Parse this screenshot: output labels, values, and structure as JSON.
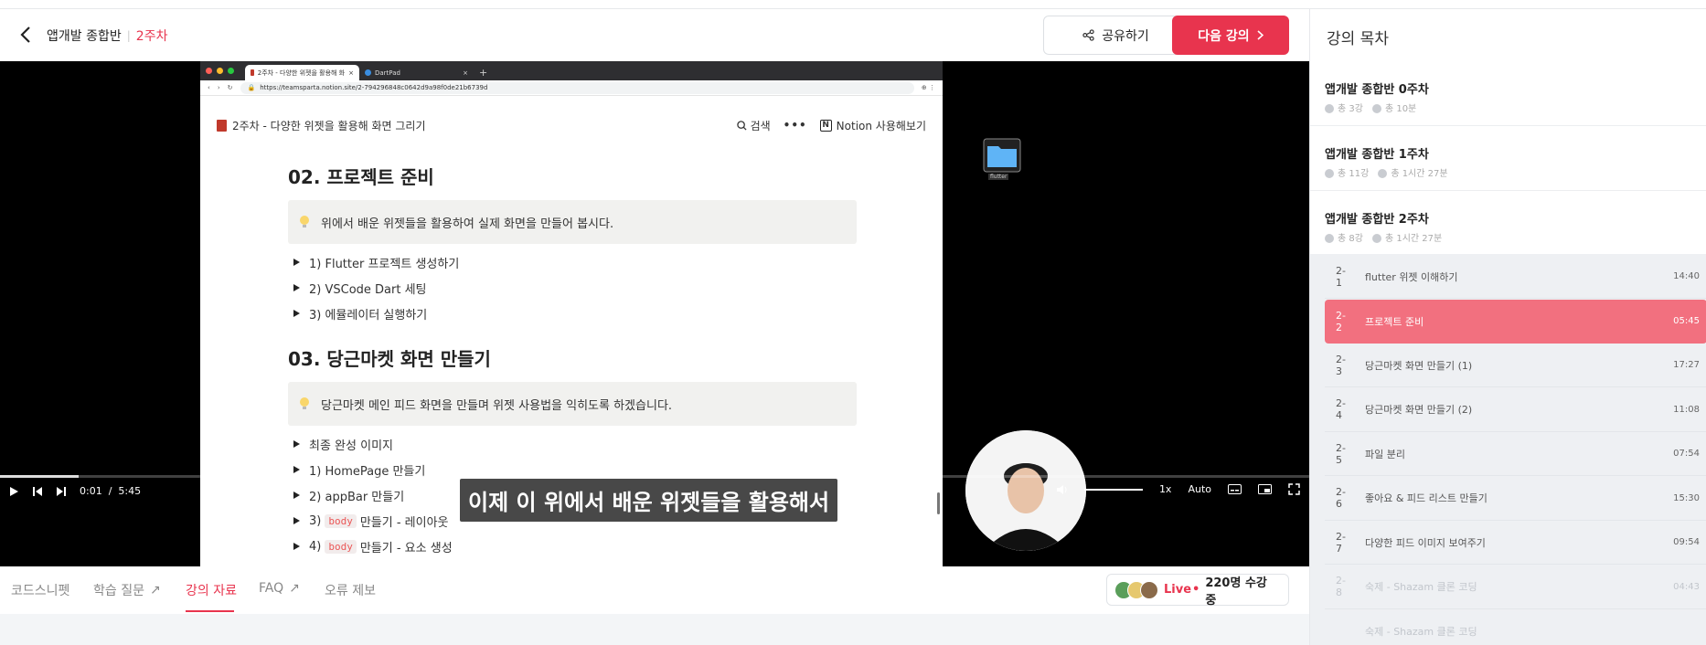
{
  "header": {
    "course": "앱개발 종합반",
    "week": "2주차",
    "share_label": "공유하기",
    "next_label": "다음 강의"
  },
  "browser": {
    "tabs": [
      {
        "label": "2주차 - 다양한 위젯을 활용해 화",
        "active": true
      },
      {
        "label": "DartPad",
        "active": false
      }
    ],
    "url": "https://teamsparta.notion.site/2-794296848c0642d9a98f0de21b6739d"
  },
  "notion": {
    "page_title": "2주차 - 다양한 위젯을 활용해 화면 그리기",
    "search_label": "검색",
    "more_label": "•••",
    "open_label": "Notion 사용해보기",
    "section1": {
      "heading": "02. 프로젝트 준비",
      "callout": "위에서 배운 위젯들을 활용하여 실제 화면을 만들어 봅시다.",
      "items": [
        "1) Flutter 프로젝트 생성하기",
        "2) VSCode Dart 세팅",
        "3) 에뮬레이터 실행하기"
      ]
    },
    "section2": {
      "heading": "03. 당근마켓 화면 만들기",
      "callout": "당근마켓 메인 피드 화면을 만들며 위젯 사용법을 익히도록 하겠습니다.",
      "items": [
        "최종 완성 이미지",
        "1) HomePage 만들기",
        "2) appBar 만들기"
      ],
      "code_items": [
        {
          "prefix": "3)",
          "code": "body",
          "suffix": "만들기 - 레이아웃"
        },
        {
          "prefix": "4)",
          "code": "body",
          "suffix": "만들기 - 요소 생성"
        }
      ]
    }
  },
  "desktop": {
    "folder_label": "flutter"
  },
  "video": {
    "subtitle": "이제 이 위에서 배운 위젯들을 활용해서",
    "current_time": "0:01",
    "time_sep": "/",
    "duration": "5:45",
    "speed": "1x",
    "quality": "Auto",
    "progress": 0.003
  },
  "bottom_tabs": [
    {
      "label": "코드스니펫",
      "external": false,
      "active": false
    },
    {
      "label": "학습 질문",
      "external": true,
      "active": false
    },
    {
      "label": "강의 자료",
      "external": false,
      "active": true
    },
    {
      "label": "FAQ",
      "external": true,
      "active": false
    },
    {
      "label": "오류 제보",
      "external": false,
      "active": false
    }
  ],
  "live": {
    "label": "Live",
    "dot": "•",
    "count": "220명 수강 중"
  },
  "sidebar": {
    "title": "강의 목차",
    "weeks": [
      {
        "title": "앱개발 종합반 0주차",
        "lectures": "총 3강",
        "duration": "총 10분"
      },
      {
        "title": "앱개발 종합반 1주차",
        "lectures": "총 11강",
        "duration": "총 1시간 27분"
      },
      {
        "title": "앱개발 종합반 2주차",
        "lectures": "총 8강",
        "duration": "총 1시간 27분"
      }
    ],
    "lessons": [
      {
        "no": "2-1",
        "name": "flutter 위젯 이해하기",
        "time": "14:40",
        "state": "normal"
      },
      {
        "no": "2-2",
        "name": "프로젝트 준비",
        "time": "05:45",
        "state": "active"
      },
      {
        "no": "2-3",
        "name": "당근마켓 화면 만들기 (1)",
        "time": "17:27",
        "state": "normal"
      },
      {
        "no": "2-4",
        "name": "당근마켓 화면 만들기 (2)",
        "time": "11:08",
        "state": "normal"
      },
      {
        "no": "2-5",
        "name": "파일 분리",
        "time": "07:54",
        "state": "normal"
      },
      {
        "no": "2-6",
        "name": "좋아요 & 피드 리스트 만들기",
        "time": "15:30",
        "state": "normal"
      },
      {
        "no": "2-7",
        "name": "다양한 피드 이미지 보여주기",
        "time": "09:54",
        "state": "normal"
      },
      {
        "no": "2-8",
        "name": "숙제 - Shazam 클론 코딩",
        "time": "04:43",
        "state": "dim"
      },
      {
        "no": "",
        "name": "숙제 - Shazam 클론 코딩",
        "time": "",
        "state": "dim"
      }
    ]
  },
  "colors": {
    "accent": "#e8344e",
    "active_lesson": "#f2707f"
  }
}
